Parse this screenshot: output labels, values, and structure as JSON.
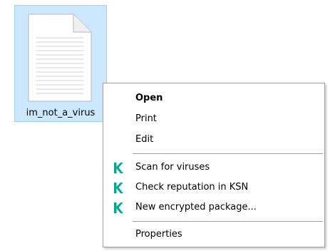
{
  "file": {
    "name": "im_not_a_virus",
    "icon": "text-document-icon"
  },
  "context_menu": {
    "items": [
      {
        "label": "Open",
        "bold": true
      },
      {
        "label": "Print"
      },
      {
        "label": "Edit"
      },
      {
        "label": "Scan for viruses",
        "icon": "kaspersky-k-icon"
      },
      {
        "label": "Check reputation in KSN",
        "icon": "kaspersky-k-icon"
      },
      {
        "label": "New encrypted package...",
        "icon": "kaspersky-k-icon"
      },
      {
        "label": "Properties"
      }
    ]
  },
  "colors": {
    "selection_bg": "#cce8ff",
    "selection_border": "#99d1ff",
    "kaspersky_green": "#00a88e",
    "menu_border": "#a0a0a0"
  }
}
